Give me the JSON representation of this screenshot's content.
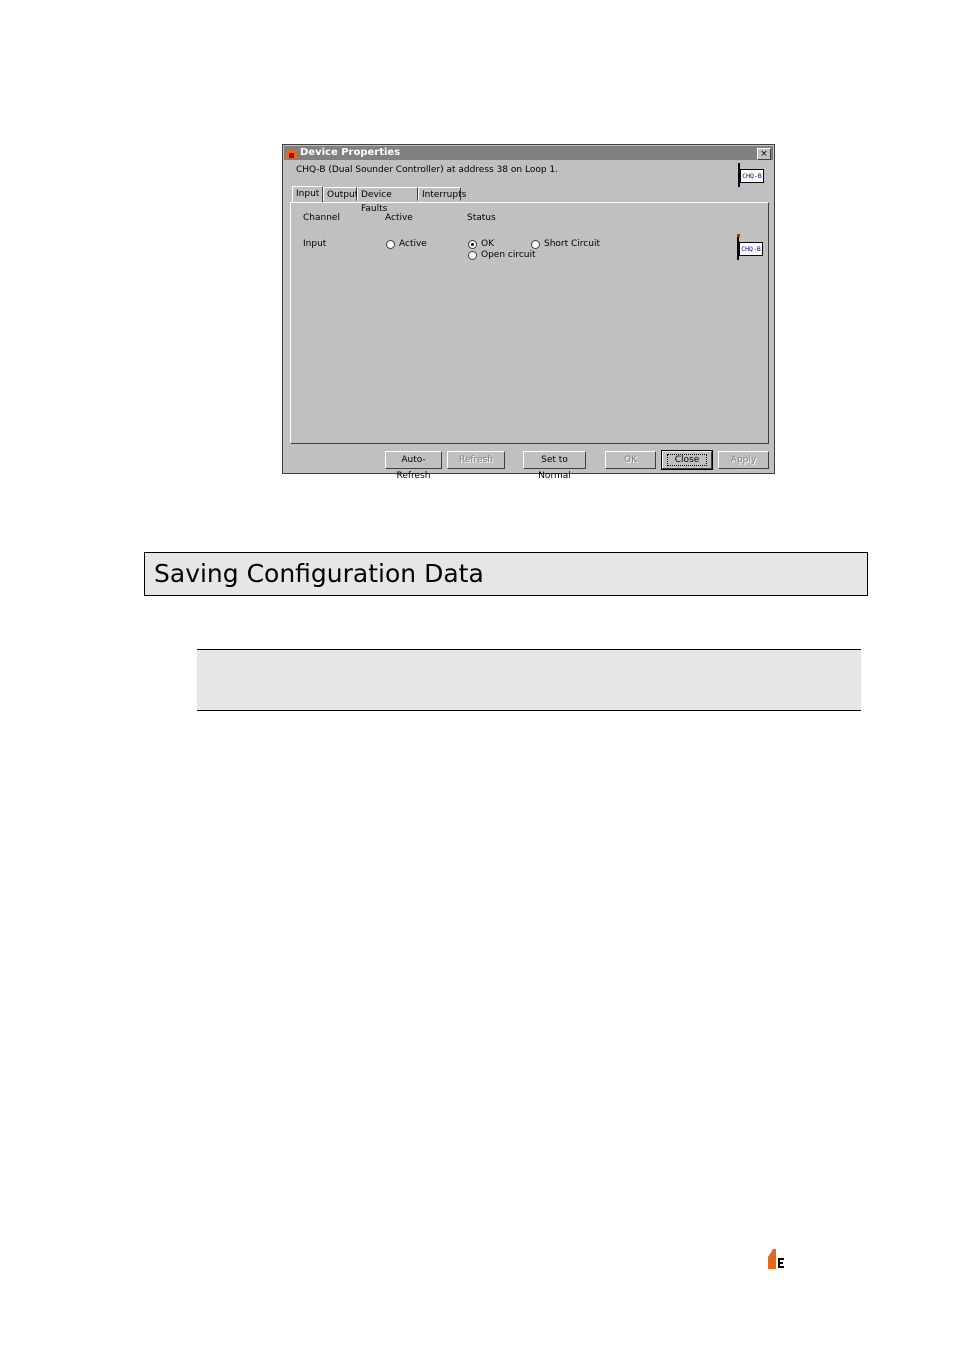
{
  "dialog": {
    "title": "Device Properties",
    "close_glyph": "×",
    "description": "CHQ-B (Dual Sounder Controller) at address 38 on Loop 1.",
    "device_tag": "CHQ-B",
    "tabs": [
      {
        "label": "Input",
        "active": true
      },
      {
        "label": "Output",
        "active": false
      },
      {
        "label": "Device Faults",
        "active": false
      },
      {
        "label": "Interrupts",
        "active": false
      }
    ],
    "columns": {
      "channel": "Channel",
      "active": "Active",
      "status": "Status"
    },
    "row": {
      "channel": "Input",
      "active_option": "Active",
      "status_options": [
        "OK",
        "Short Circuit",
        "Open circuit"
      ],
      "status_selected": "OK"
    },
    "buttons": {
      "auto_refresh": "Auto-Refresh",
      "refresh": "Refresh",
      "set_normal": "Set to Normal",
      "ok": "OK",
      "close": "Close",
      "apply": "Apply"
    }
  },
  "section": {
    "heading": "Saving Configuration Data"
  },
  "colors": {
    "title_bar": "#808080",
    "dialog_face": "#c0c0c0",
    "section_bg": "#e6e6e6",
    "logo_orange": "#e8681a"
  }
}
